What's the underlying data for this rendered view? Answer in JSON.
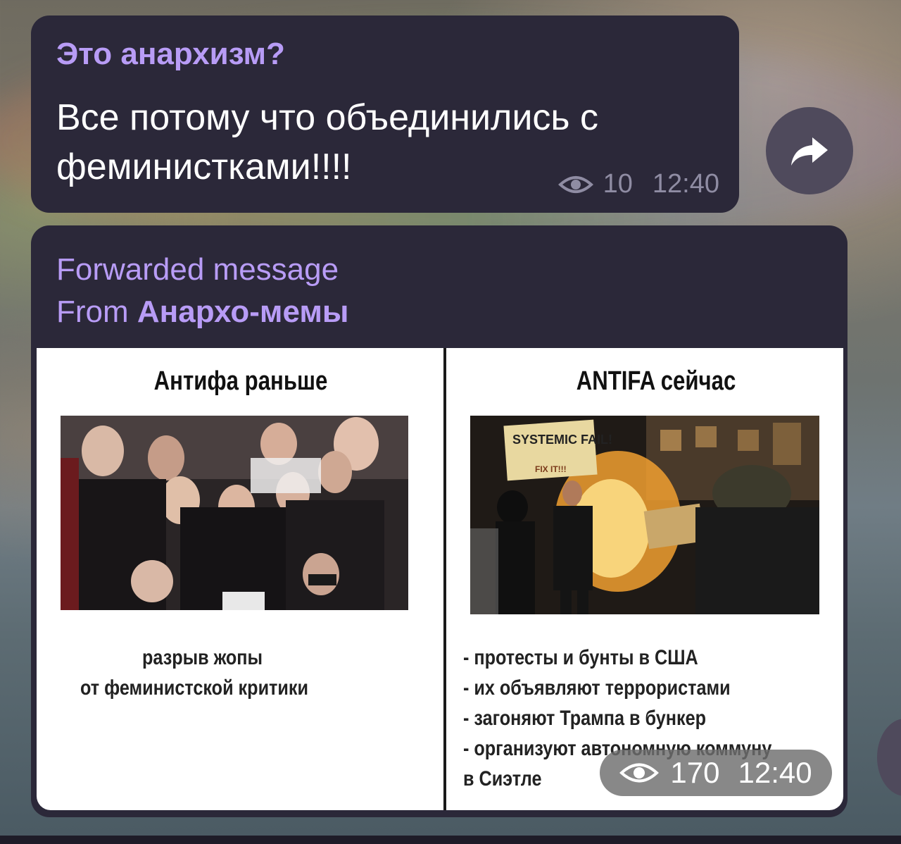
{
  "message1": {
    "author": "Это анархизм?",
    "text": "Все потому что объединились с феминистками!!!!",
    "views": "10",
    "time": "12:40",
    "icon": "eye-icon"
  },
  "share": {
    "icon": "share-arrow-icon"
  },
  "message2": {
    "forwarded_label": "Forwarded message",
    "from_label": "From",
    "from_channel": "Анархо-мемы",
    "views": "170",
    "time": "12:40",
    "meme": {
      "left_title": "Антифа раньше",
      "right_title": "ANTIFA сейчас",
      "left_caption": [
        "разрыв жопы",
        "от феминистской критики"
      ],
      "right_caption": [
        "- протесты и бунты в США",
        "- их объявляют террористами",
        "- загоняют Трампа в бункер",
        "- организуют автономную коммуну",
        "в Сиэтле"
      ],
      "sign_text": [
        "SYSTEMIC FAIL!",
        "FIX IT!!!"
      ]
    }
  },
  "colors": {
    "bubble": "#2b2839",
    "accent": "#b89cf6",
    "meta": "#8f8ca3"
  }
}
